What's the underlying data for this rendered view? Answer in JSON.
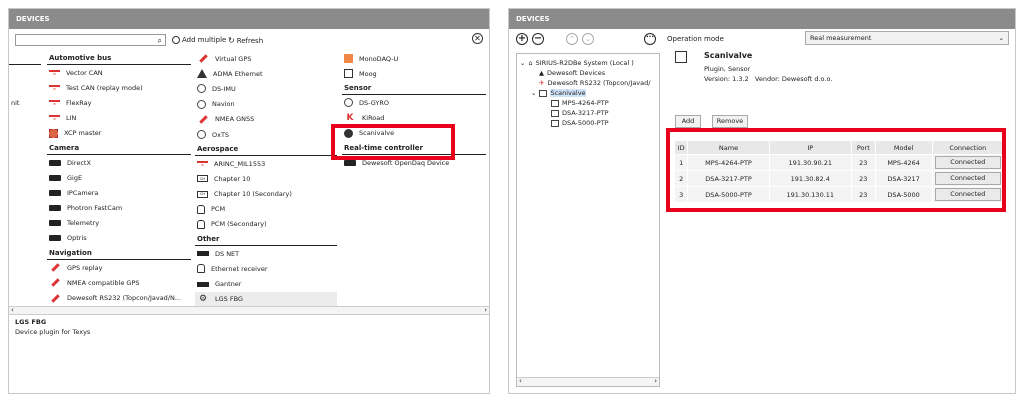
{
  "left_panel": {
    "title": "DEVICES",
    "search_value": "",
    "add_multiple": "Add multiple",
    "refresh": "Refresh",
    "stub_text": "nit",
    "groups_col1": [
      {
        "header": "Automotive bus",
        "items": [
          {
            "label": "Vector CAN",
            "icon": "can-icon"
          },
          {
            "label": "Test CAN (replay mode)",
            "icon": "can-icon"
          },
          {
            "label": "FlexRay",
            "icon": "can-icon"
          },
          {
            "label": "LIN",
            "icon": "can-icon"
          },
          {
            "label": "XCP master",
            "icon": "chip-icon"
          }
        ]
      },
      {
        "header": "Camera",
        "items": [
          {
            "label": "DirectX",
            "icon": "camera-icon"
          },
          {
            "label": "GigE",
            "icon": "camera-icon"
          },
          {
            "label": "IPCamera",
            "icon": "camera-icon"
          },
          {
            "label": "Photron FastCam",
            "icon": "camera-icon"
          },
          {
            "label": "Telemetry",
            "icon": "camera-icon"
          },
          {
            "label": "Optris",
            "icon": "camera-icon"
          }
        ]
      },
      {
        "header": "Navigation",
        "items": [
          {
            "label": "GPS replay",
            "icon": "satellite-icon"
          },
          {
            "label": "NMEA compatible GPS",
            "icon": "satellite-icon"
          },
          {
            "label": "Dewesoft RS232 (Topcon/Javad/N...",
            "icon": "satellite-icon"
          }
        ]
      }
    ],
    "groups_col2_top": [
      {
        "label": "Virtual GPS",
        "icon": "satellite-icon"
      },
      {
        "label": "ADMA Ethernet",
        "icon": "warning-icon"
      },
      {
        "label": "DS-IMU",
        "icon": "compass-icon"
      },
      {
        "label": "Navion",
        "icon": "compass-icon"
      },
      {
        "label": "NMEA GNSS",
        "icon": "satellite-icon"
      },
      {
        "label": "OxTS",
        "icon": "compass-icon"
      }
    ],
    "groups_col2": [
      {
        "header": "Aerospace",
        "items": [
          {
            "label": "ARINC_MIL1553",
            "icon": "can-icon"
          },
          {
            "label": "Chapter 10",
            "icon": "chapter-icon"
          },
          {
            "label": "Chapter 10 (Secondary)",
            "icon": "chapter-icon"
          },
          {
            "label": "PCM",
            "icon": "person-icon"
          },
          {
            "label": "PCM (Secondary)",
            "icon": "person-icon"
          }
        ]
      },
      {
        "header": "Other",
        "items": [
          {
            "label": "DS NET",
            "icon": "network-icon"
          },
          {
            "label": "Ethernet receiver",
            "icon": "ethernet-icon"
          },
          {
            "label": "Gantner",
            "icon": "network-icon"
          },
          {
            "label": "LGS FBG",
            "icon": "gear-icon"
          }
        ]
      }
    ],
    "groups_col3_top": [
      {
        "label": "MonoDAQ-U",
        "icon": "monodaq-icon"
      },
      {
        "label": "Moog",
        "icon": "moog-icon"
      }
    ],
    "groups_col3": [
      {
        "header": "Sensor",
        "items": [
          {
            "label": "DS-GYRO",
            "icon": "compass-icon"
          },
          {
            "label": "KiRoad",
            "icon": "kiroad-icon"
          },
          {
            "label": "Scanivalve",
            "icon": "scanivalve-icon"
          }
        ]
      },
      {
        "header": "Real-time controller",
        "items": [
          {
            "label": "Dewesoft OpenDaq Device",
            "icon": "camera-icon"
          }
        ]
      }
    ],
    "info_title": "LGS FBG",
    "info_desc": "Device plugin for Texys"
  },
  "right_panel": {
    "title": "DEVICES",
    "operation_mode_label": "Operation mode",
    "operation_mode_value": "Real measurement",
    "tree": {
      "root": "SIRIUS-R2DBe System (Local )",
      "children": [
        "Dewesoft Devices",
        "Dewesoft RS232 (Topcon/Javad/",
        "Scanivalve"
      ],
      "grandchildren": [
        "MPS-4264-PTP",
        "DSA-3217-PTP",
        "DSA-5000-PTP"
      ]
    },
    "device": {
      "name": "Scanivalve",
      "type": "Plugin, Sensor",
      "version": "Version: 1.3.2",
      "vendor": "Vendor: Dewesoft d.o.o."
    },
    "add_label": "Add",
    "remove_label": "Remove",
    "table": {
      "headers": [
        "ID",
        "Name",
        "IP",
        "Port",
        "Model",
        "Connection"
      ],
      "rows": [
        [
          "1",
          "MPS-4264-PTP",
          "191.30.90.21",
          "23",
          "MPS-4264",
          "Connected"
        ],
        [
          "2",
          "DSA-3217-PTP",
          "191.30.82.4",
          "23",
          "DSA-3217",
          "Connected"
        ],
        [
          "3",
          "DSA-5000-PTP",
          "191.30.130.11",
          "23",
          "DSA-5000",
          "Connected"
        ]
      ]
    }
  },
  "colors": {
    "highlight": "#e8001c",
    "titlebar": "#8b8b8b"
  }
}
